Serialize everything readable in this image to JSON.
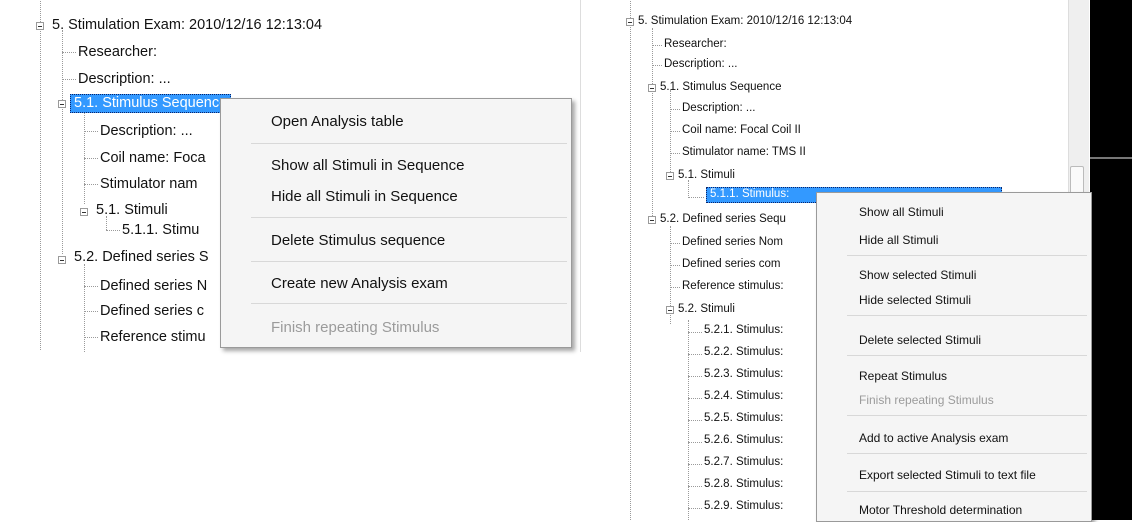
{
  "left": {
    "tree": {
      "exam": "5. Stimulation Exam: 2010/12/16 12:13:04",
      "researcher": "Researcher:",
      "description": "Description: ...",
      "sequence": "5.1. Stimulus Sequence",
      "seq_description": "Description: ...",
      "coil": "Coil name: Foca",
      "stimulator": "Stimulator nam",
      "stimuli_group": "5.1. Stimuli",
      "stimulus": "5.1.1. Stimu",
      "defined_series": "5.2. Defined series S",
      "defined_name": "Defined series N",
      "defined_comment": "Defined series c",
      "reference": "Reference stimu"
    },
    "menu": {
      "items": [
        "Open Analysis table",
        "Show all Stimuli in Sequence",
        "Hide all Stimuli in Sequence",
        "Delete Stimulus sequence",
        "Create new Analysis exam",
        "Finish repeating Stimulus"
      ]
    }
  },
  "right": {
    "tree": {
      "exam": "5. Stimulation Exam: 2010/12/16 12:13:04",
      "researcher": "Researcher:",
      "description": "Description: ...",
      "sequence": "5.1. Stimulus Sequence",
      "seq_description": "Description: ...",
      "coil": "Coil name: Focal Coil II",
      "stimulator": "Stimulator name: TMS II",
      "stimuli_group": "5.1. Stimuli",
      "stimulus_selected": "5.1.1. Stimulus:",
      "defined_series": "5.2. Defined series Sequ",
      "defined_name": "Defined series Nom",
      "defined_comment": "Defined series com",
      "reference": "Reference stimulus:",
      "stimuli_group2": "5.2. Stimuli",
      "stimuli": [
        "5.2.1. Stimulus:",
        "5.2.2. Stimulus:",
        "5.2.3. Stimulus:",
        "5.2.4. Stimulus:",
        "5.2.5. Stimulus:",
        "5.2.6. Stimulus:",
        "5.2.7. Stimulus:",
        "5.2.8. Stimulus:",
        "5.2.9. Stimulus:"
      ]
    },
    "menu": {
      "items": [
        "Show all Stimuli",
        "Hide all Stimuli",
        "Show selected Stimuli",
        "Hide selected Stimuli",
        "Delete selected Stimuli",
        "Repeat Stimulus",
        "Finish repeating Stimulus",
        "Add to active Analysis exam",
        "Export selected Stimuli to text file",
        "Motor Threshold determination"
      ]
    }
  },
  "colors": {
    "selection": "#3399ff",
    "menu_background": "#f5f5f5",
    "disabled_text": "#9b9b9b"
  }
}
